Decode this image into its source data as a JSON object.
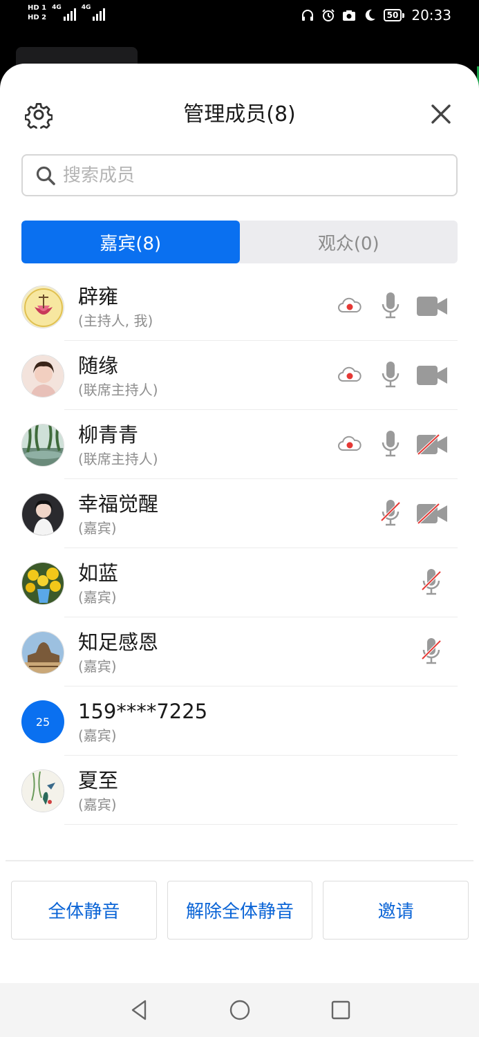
{
  "status": {
    "hd1": "HD 1",
    "hd2": "HD 2",
    "net1": "4G",
    "net2": "4G",
    "battery": "50",
    "time": "20:33"
  },
  "header": {
    "title": "管理成员(8)"
  },
  "search": {
    "placeholder": "搜索成员"
  },
  "tabs": [
    {
      "label": "嘉宾(8)",
      "active": true
    },
    {
      "label": "观众(0)",
      "active": false
    }
  ],
  "members": [
    {
      "name": "辟雍",
      "role": "(主持人, 我)",
      "recording": true,
      "mic": "on",
      "camera": "on"
    },
    {
      "name": "随缘",
      "role": "(联席主持人)",
      "recording": true,
      "mic": "on",
      "camera": "on"
    },
    {
      "name": "柳青青",
      "role": "(联席主持人)",
      "recording": true,
      "mic": "on",
      "camera": "off"
    },
    {
      "name": "幸福觉醒",
      "role": "(嘉宾)",
      "recording": false,
      "mic": "off",
      "camera": "off"
    },
    {
      "name": "如蓝",
      "role": "(嘉宾)",
      "recording": false,
      "mic": "off",
      "camera": "none"
    },
    {
      "name": "知足感恩",
      "role": "(嘉宾)",
      "recording": false,
      "mic": "off",
      "camera": "none"
    },
    {
      "name": "159****7225",
      "role": "(嘉宾)",
      "avatar_text": "25",
      "recording": false,
      "mic": "none",
      "camera": "none"
    },
    {
      "name": "夏至",
      "role": "(嘉宾)",
      "recording": false,
      "mic": "none",
      "camera": "none"
    }
  ],
  "actions": {
    "mute_all": "全体静音",
    "unmute_all": "解除全体静音",
    "invite": "邀请"
  },
  "colors": {
    "accent": "#0a70f0",
    "record_red": "#e53935",
    "icon_gray": "#9a9a9a"
  }
}
